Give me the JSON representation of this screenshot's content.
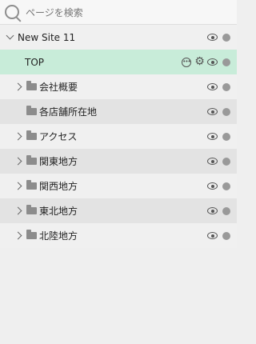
{
  "search": {
    "placeholder": "ページを検索"
  },
  "tree": {
    "site": {
      "label": "New Site 11"
    },
    "top": {
      "label": "TOP"
    },
    "items": [
      {
        "label": "会社概要",
        "has_children": true
      },
      {
        "label": "各店舗所在地",
        "has_children": false
      },
      {
        "label": "アクセス",
        "has_children": true
      },
      {
        "label": "関東地方",
        "has_children": true
      },
      {
        "label": "関西地方",
        "has_children": true
      },
      {
        "label": "東北地方",
        "has_children": true
      },
      {
        "label": "北陸地方",
        "has_children": true
      }
    ]
  },
  "icons": {
    "search": "search-icon",
    "expand": "chevron-down-icon",
    "collapse": "chevron-right-icon",
    "folder": "folder-icon",
    "more": "more-options-icon",
    "settings": "gear-icon",
    "visibility": "eye-icon",
    "status": "status-dot-icon"
  },
  "colors": {
    "selected_row": "#c8ecd9",
    "background": "#efefef"
  }
}
